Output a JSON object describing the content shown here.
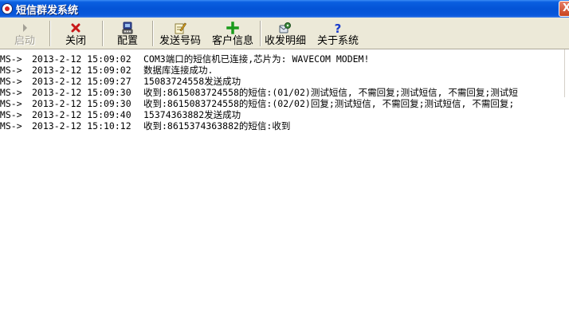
{
  "window": {
    "title": "短信群发系统",
    "close_glyph": "X"
  },
  "toolbar": {
    "start": {
      "label": "启动",
      "icon": "play-arrow-icon",
      "enabled": false
    },
    "close": {
      "label": "关闭",
      "icon": "red-x-icon"
    },
    "config": {
      "label": "配置",
      "icon": "config-device-icon"
    },
    "send_number": {
      "label": "发送号码",
      "icon": "pencil-note-icon"
    },
    "customer_info": {
      "label": "客户信息",
      "icon": "green-plus-icon"
    },
    "send_receive_detail": {
      "label": "收发明细",
      "icon": "message-gear-icon"
    },
    "about": {
      "label": "关于系统",
      "icon": "question-mark-icon"
    }
  },
  "colors": {
    "titlebar": "#0453d6",
    "toolbar_bg": "#ece9d8",
    "close_red": "#c8421e",
    "plus_green": "#1a9a1a",
    "help_blue": "#1a3ccc"
  },
  "log": [
    {
      "source": "SMS->",
      "time": "2013-2-12 15:09:02",
      "message": "COM3端口的短信机已连接,芯片为: WAVECOM MODEM!"
    },
    {
      "source": "SMS->",
      "time": "2013-2-12 15:09:02",
      "message": "数据库连接成功."
    },
    {
      "source": "SMS->",
      "time": "2013-2-12 15:09:27",
      "message": "15083724558发送成功"
    },
    {
      "source": "SMS->",
      "time": "2013-2-12 15:09:30",
      "message": "收到:8615083724558的短信:(01/02)测试短信, 不需回复;测试短信, 不需回复;测试短"
    },
    {
      "source": "SMS->",
      "time": "2013-2-12 15:09:30",
      "message": "收到:8615083724558的短信:(02/02)回复;测试短信, 不需回复;测试短信, 不需回复;"
    },
    {
      "source": "SMS->",
      "time": "2013-2-12 15:09:40",
      "message": "15374363882发送成功"
    },
    {
      "source": "SMS->",
      "time": "2013-2-12 15:10:12",
      "message": "收到:8615374363882的短信:收到"
    }
  ]
}
